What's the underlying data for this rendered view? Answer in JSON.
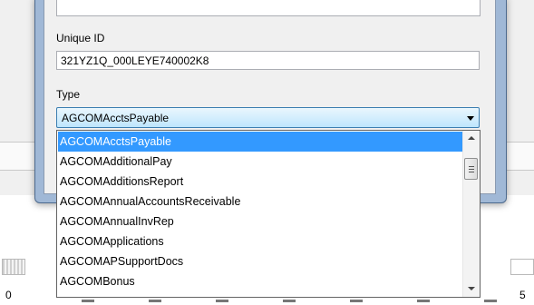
{
  "form": {
    "unique_id_label": "Unique ID",
    "unique_id_value": "321YZ1Q_000LEYE740002K8",
    "type_label": "Type",
    "type_selected": "AGCOMAcctsPayable"
  },
  "dropdown": {
    "items": [
      "AGCOMAcctsPayable",
      "AGCOMAdditionalPay",
      "AGCOMAdditionsReport",
      "AGCOMAnnualAccountsReceivable",
      "AGCOMAnnualInvRep",
      "AGCOMApplications",
      "AGCOMAPSupportDocs",
      "AGCOMBonus"
    ],
    "selected_index": 0
  },
  "background": {
    "axis_left_label": "0",
    "axis_right_label": "5"
  },
  "colors": {
    "selection": "#3399ff",
    "dialog_frame": "#a0b8d6"
  }
}
